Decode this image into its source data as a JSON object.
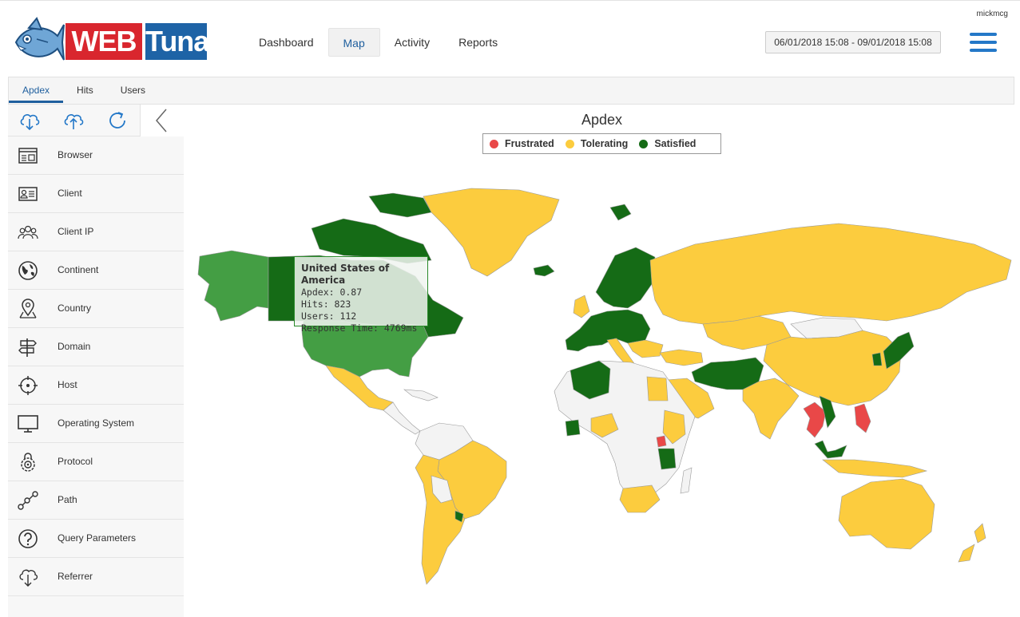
{
  "header": {
    "logo": {
      "word1": "WEB",
      "word2": "Tuna"
    },
    "nav": [
      {
        "label": "Dashboard",
        "active": false
      },
      {
        "label": "Map",
        "active": true
      },
      {
        "label": "Activity",
        "active": false
      },
      {
        "label": "Reports",
        "active": false
      }
    ],
    "date_range": "06/01/2018 15:08 - 09/01/2018 15:08",
    "username": "mickmcg",
    "menu_icon": "hamburger-icon"
  },
  "subtabs": [
    {
      "label": "Apdex",
      "active": true
    },
    {
      "label": "Hits",
      "active": false
    },
    {
      "label": "Users",
      "active": false
    }
  ],
  "sidebar": {
    "tools": [
      "download-cloud-icon",
      "upload-cloud-icon",
      "refresh-icon",
      "collapse-chevron-icon"
    ],
    "items": [
      {
        "label": "Browser",
        "icon": "browser-window-icon"
      },
      {
        "label": "Client",
        "icon": "id-card-icon"
      },
      {
        "label": "Client IP",
        "icon": "users-group-icon"
      },
      {
        "label": "Continent",
        "icon": "globe-icon"
      },
      {
        "label": "Country",
        "icon": "map-pin-icon"
      },
      {
        "label": "Domain",
        "icon": "signpost-icon"
      },
      {
        "label": "Host",
        "icon": "crosshair-icon"
      },
      {
        "label": "Operating System",
        "icon": "monitor-icon"
      },
      {
        "label": "Protocol",
        "icon": "lock-gear-icon"
      },
      {
        "label": "Path",
        "icon": "path-nodes-icon"
      },
      {
        "label": "Query Parameters",
        "icon": "question-circle-icon"
      },
      {
        "label": "Referrer",
        "icon": "cloud-download-icon"
      }
    ]
  },
  "chart": {
    "title": "Apdex",
    "legend": [
      {
        "label": "Frustrated",
        "color": "#e94848"
      },
      {
        "label": "Tolerating",
        "color": "#fccc3e"
      },
      {
        "label": "Satisfied",
        "color": "#156b16"
      }
    ],
    "colors": {
      "no_data": "#f3f3f3",
      "highlight": "#449e44",
      "border": "#999999"
    },
    "tooltip": {
      "title": "United States of America",
      "lines": [
        "Apdex: 0.87",
        "Hits: 823",
        "Users: 112",
        "Response Time: 4769ms"
      ]
    }
  }
}
